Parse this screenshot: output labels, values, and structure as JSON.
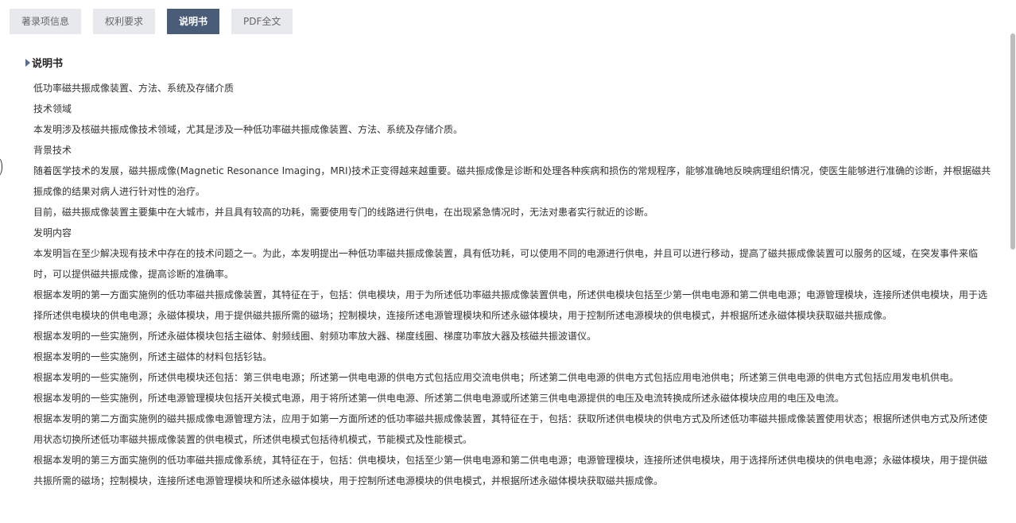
{
  "tabs": [
    {
      "label": "著录项信息",
      "active": false
    },
    {
      "label": "权利要求",
      "active": false
    },
    {
      "label": "说明书",
      "active": true
    },
    {
      "label": "PDF全文",
      "active": false
    }
  ],
  "section": {
    "title": "说明书"
  },
  "paragraphs": [
    "低功率磁共振成像装置、方法、系统及存储介质",
    "技术领域",
    "本发明涉及核磁共振成像技术领域，尤其是涉及一种低功率磁共振成像装置、方法、系统及存储介质。",
    "背景技术",
    "随着医学技术的发展，磁共振成像(Magnetic Resonance Imaging，MRI)技术正变得越来越重要。磁共振成像是诊断和处理各种疾病和损伤的常规程序，能够准确地反映病理组织情况，使医生能够进行准确的诊断，并根据磁共振成像的结果对病人进行针对性的治疗。",
    "目前，磁共振成像装置主要集中在大城市，并且具有较高的功耗，需要使用专门的线路进行供电，在出现紧急情况时，无法对患者实行就近的诊断。",
    "发明内容",
    "本发明旨在至少解决现有技术中存在的技术问题之一。为此，本发明提出一种低功率磁共振成像装置，具有低功耗，可以使用不同的电源进行供电，并且可以进行移动，提高了磁共振成像装置可以服务的区域，在突发事件来临时，可以提供磁共振成像，提高诊断的准确率。",
    "根据本发明的第一方面实施例的低功率磁共振成像装置，其特征在于，包括：供电模块，用于为所述低功率磁共振成像装置供电，所述供电模块包括至少第一供电电源和第二供电电源；电源管理模块，连接所述供电模块，用于选择所述供电模块的供电电源；永磁体模块，用于提供磁共振所需的磁场；控制模块，连接所述电源管理模块和所述永磁体模块，用于控制所述电源模块的供电模式，并根据所述永磁体模块获取磁共振成像。",
    "根据本发明的一些实施例，所述永磁体模块包括主磁体、射频线圈、射频功率放大器、梯度线圈、梯度功率放大器及核磁共振波谱仪。",
    "根据本发明的一些实施例，所述主磁体的材料包括钐钴。",
    "根据本发明的一些实施例，所述供电模块还包括：第三供电电源；所述第一供电电源的供电方式包括应用交流电供电；所述第二供电电源的供电方式包括应用电池供电；所述第三供电电源的供电方式包括应用发电机供电。",
    "根据本发明的一些实施例，所述电源管理模块包括开关模式电源，用于将所述第一供电电源、所述第二供电电源或所述第三供电电源提供的电压及电流转换成所述永磁体模块应用的电压及电流。",
    "根据本发明的第二方面实施例的磁共振成像电源管理方法，应用于如第一方面所述的低功率磁共振成像装置，其特征在于，包括：获取所述供电模块的供电方式及所述低功率磁共振成像装置使用状态；根据所述供电方式及所述使用状态切换所述低功率磁共振成像装置的供电模式，所述供电模式包括待机模式，节能模式及性能模式。",
    "根据本发明的第三方面实施例的低功率磁共振成像系统，其特征在于，包括：供电模块，包括至少第一供电电源和第二供电电源；电源管理模块，连接所述供电模块，用于选择所述供电模块的供电电源；永磁体模块，用于提供磁共振所需的磁场；控制模块，连接所述电源管理模块和所述永磁体模块，用于控制所述电源模块的供电模式，并根据所述永磁体模块获取磁共振成像。"
  ]
}
